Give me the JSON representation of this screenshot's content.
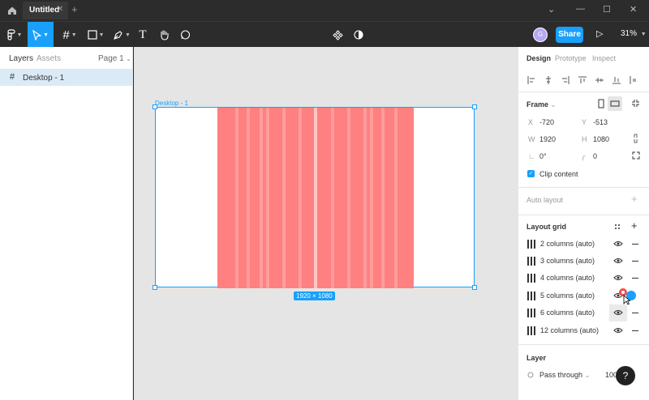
{
  "window": {
    "tab_title": "Untitled",
    "tab_close": "✕",
    "new_tab": "+"
  },
  "toolbar": {
    "share_label": "Share",
    "zoom_label": "31%",
    "avatar_initial": "G"
  },
  "left_panel": {
    "tab_layers": "Layers",
    "tab_assets": "Assets",
    "page_label": "Page 1",
    "layers": [
      {
        "name": "Desktop - 1"
      }
    ]
  },
  "canvas": {
    "frame_label": "Desktop - 1",
    "dimensions_badge": "1920 × 1080"
  },
  "right_panel": {
    "tabs": [
      "Design",
      "Prototype",
      "Inspect"
    ],
    "frame_section": "Frame",
    "x_label": "X",
    "x_value": "-720",
    "y_label": "Y",
    "y_value": "-513",
    "w_label": "W",
    "w_value": "1920",
    "h_label": "H",
    "h_value": "1080",
    "rotation_value": "0°",
    "radius_value": "0",
    "clip_content_label": "Clip content",
    "auto_layout_label": "Auto layout",
    "layout_grid_label": "Layout grid",
    "layout_grids": [
      {
        "label": "2 columns (auto)"
      },
      {
        "label": "3 columns (auto)"
      },
      {
        "label": "4 columns (auto)"
      },
      {
        "label": "5 columns (auto)"
      },
      {
        "label": "6 columns (auto)"
      },
      {
        "label": "12 columns (auto)"
      }
    ],
    "layer_section": "Layer",
    "blend_mode": "Pass through",
    "opacity_value": "100"
  },
  "help_label": "?",
  "colors": {
    "accent": "#18a0fb",
    "grid_fill": "#ff8080",
    "toolbar_bg": "#2c2c2c",
    "canvas_bg": "#e5e5e5"
  }
}
